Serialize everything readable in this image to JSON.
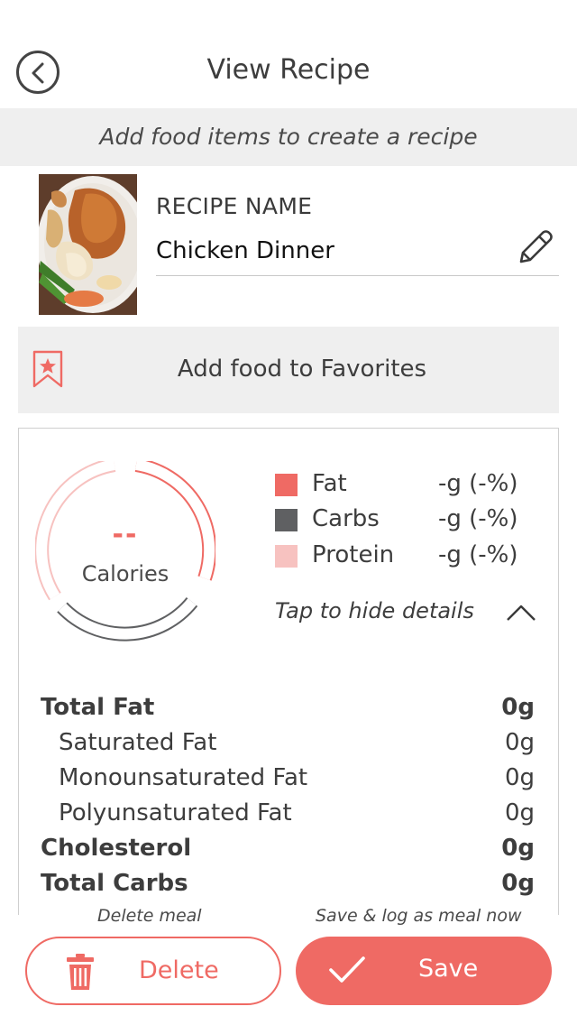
{
  "header": {
    "title": "View Recipe"
  },
  "hint_bar": {
    "text": "Add food items to create a recipe"
  },
  "recipe": {
    "name_label": "RECIPE NAME",
    "name_value": "Chicken Dinner"
  },
  "favorites": {
    "label": "Add food to Favorites"
  },
  "summary": {
    "calories_value": "--",
    "calories_label": "Calories",
    "macros": [
      {
        "name": "Fat",
        "value": "-g (-%)",
        "color": "#ef6a64"
      },
      {
        "name": "Carbs",
        "value": "-g (-%)",
        "color": "#5f6062"
      },
      {
        "name": "Protein",
        "value": "-g (-%)",
        "color": "#f7c2c0"
      }
    ],
    "toggle_label": "Tap to hide details"
  },
  "nutrients": [
    {
      "name": "Total Fat",
      "value": "0g",
      "bold": true
    },
    {
      "name": "Saturated Fat",
      "value": "0g",
      "bold": false
    },
    {
      "name": "Monounsaturated Fat",
      "value": "0g",
      "bold": false
    },
    {
      "name": "Polyunsaturated Fat",
      "value": "0g",
      "bold": false
    },
    {
      "name": "Cholesterol",
      "value": "0g",
      "bold": true
    },
    {
      "name": "Total Carbs",
      "value": "0g",
      "bold": true
    }
  ],
  "footer": {
    "delete_hint": "Delete meal",
    "save_hint": "Save & log as meal now",
    "delete_label": "Delete",
    "save_label": "Save"
  },
  "colors": {
    "accent": "#ef6a64",
    "panel_gray": "#efefef"
  }
}
